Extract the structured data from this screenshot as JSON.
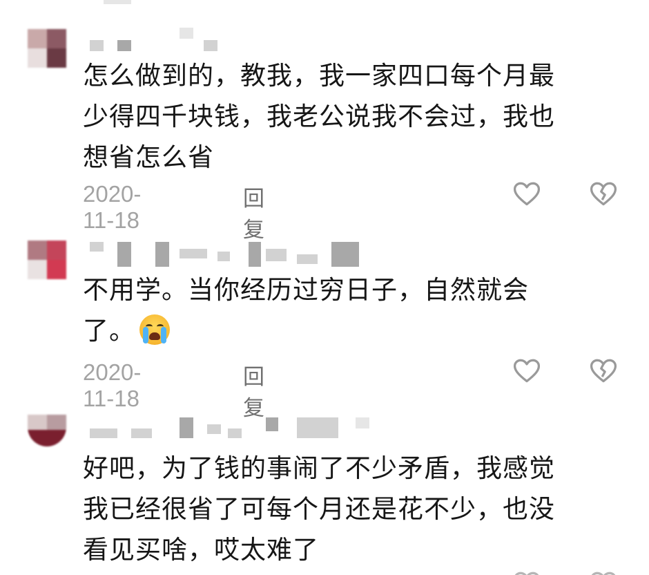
{
  "comments": [
    {
      "text": "怎么做到的，教我，我一家四口每个月最\n少得四千块钱，我老公说我不会过，我也\n想省怎么省",
      "date": "2020-11-18",
      "reply_label": "回复",
      "like_icon": "heart-outline-icon",
      "dislike_icon": "broken-heart-icon"
    },
    {
      "text": "不用学。当你经历过穷日子，自然就会\n了。",
      "emoji": "loudly-crying-face",
      "date": "2020-11-18",
      "reply_label": "回复",
      "like_icon": "heart-outline-icon",
      "dislike_icon": "broken-heart-icon"
    },
    {
      "text": "好吧，为了钱的事闹了不少矛盾，我感觉\n我已经很省了可每个月还是花不少，也没\n看见买啥，哎太难了"
    }
  ],
  "colors": {
    "text": "#161616",
    "meta": "#a3a3a3",
    "reply": "#707070",
    "icon": "#9a9a9a"
  }
}
